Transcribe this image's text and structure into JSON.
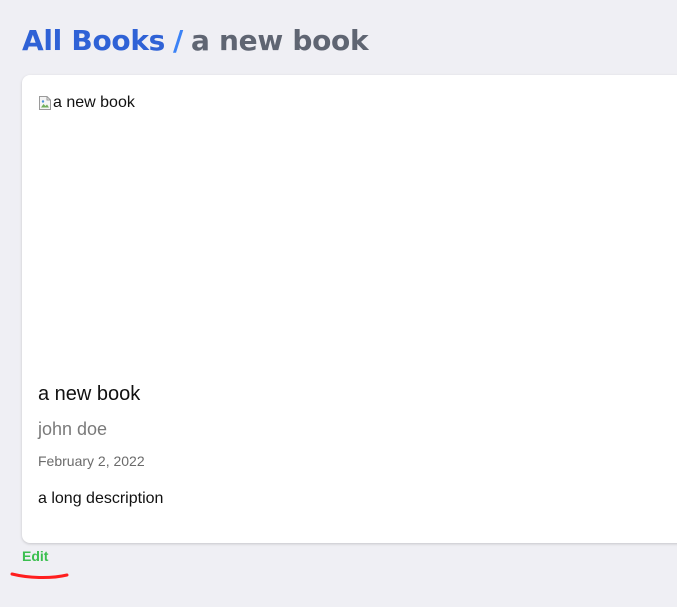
{
  "breadcrumb": {
    "root_label": "All Books",
    "separator": "/",
    "current_label": "a new book"
  },
  "book": {
    "cover_alt": "a new book",
    "title": "a new book",
    "author": "john doe",
    "date": "February 2, 2022",
    "description": "a long description"
  },
  "actions": {
    "edit_label": "Edit"
  },
  "colors": {
    "link_blue": "#2f62d6",
    "separator_blue": "#3b82f6",
    "current_gray": "#5f6572",
    "edit_green": "#3bbf4f",
    "annotation_red": "#ff1e1e",
    "page_background": "#efeff4",
    "card_background": "#ffffff"
  },
  "icons": {
    "cover_placeholder": "broken-image-icon"
  }
}
